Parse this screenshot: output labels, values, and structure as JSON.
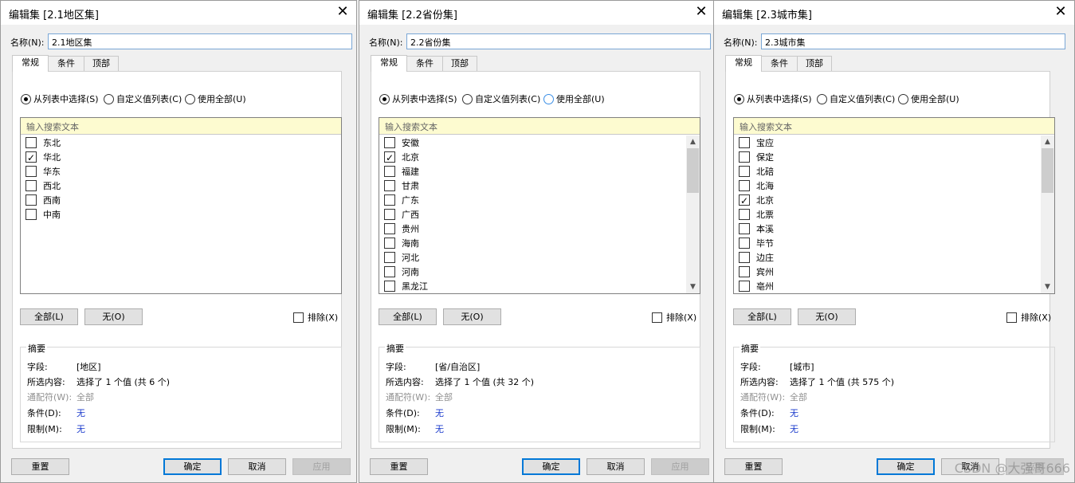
{
  "dialogs": [
    {
      "title": "编辑集 [2.1地区集]",
      "name_label": "名称(N):",
      "name_value": "2.1地区集",
      "tabs": [
        "常规",
        "条件",
        "顶部"
      ],
      "radios": [
        "从列表中选择(S)",
        "自定义值列表(C)",
        "使用全部(U)"
      ],
      "search_placeholder": "输入搜索文本",
      "items": [
        {
          "label": "东北",
          "checked": false
        },
        {
          "label": "华北",
          "checked": true
        },
        {
          "label": "华东",
          "checked": false
        },
        {
          "label": "西北",
          "checked": false
        },
        {
          "label": "西南",
          "checked": false
        },
        {
          "label": "中南",
          "checked": false
        }
      ],
      "btn_all": "全部(L)",
      "btn_none": "无(O)",
      "exclude_label": "排除(X)",
      "summary_title": "摘要",
      "summary": {
        "field_label": "字段:",
        "field_value": "[地区]",
        "selected_label": "所选内容:",
        "selected_value": "选择了 1 个值 (共 6 个)",
        "wildcard_label": "通配符(W):",
        "wildcard_value": "全部",
        "condition_label": "条件(D):",
        "condition_value": "无",
        "limit_label": "限制(M):",
        "limit_value": "无"
      },
      "btn_reset": "重置",
      "btn_ok": "确定",
      "btn_cancel": "取消",
      "btn_apply": "应用"
    },
    {
      "title": "编辑集 [2.2省份集]",
      "name_label": "名称(N):",
      "name_value": "2.2省份集",
      "tabs": [
        "常规",
        "条件",
        "顶部"
      ],
      "radios": [
        "从列表中选择(S)",
        "自定义值列表(C)",
        "使用全部(U)"
      ],
      "search_placeholder": "输入搜索文本",
      "items": [
        {
          "label": "安徽",
          "checked": false
        },
        {
          "label": "北京",
          "checked": true
        },
        {
          "label": "福建",
          "checked": false
        },
        {
          "label": "甘肃",
          "checked": false
        },
        {
          "label": "广东",
          "checked": false
        },
        {
          "label": "广西",
          "checked": false
        },
        {
          "label": "贵州",
          "checked": false
        },
        {
          "label": "海南",
          "checked": false
        },
        {
          "label": "河北",
          "checked": false
        },
        {
          "label": "河南",
          "checked": false
        },
        {
          "label": "黑龙江",
          "checked": false
        }
      ],
      "btn_all": "全部(L)",
      "btn_none": "无(O)",
      "exclude_label": "排除(X)",
      "summary_title": "摘要",
      "summary": {
        "field_label": "字段:",
        "field_value": "[省/自治区]",
        "selected_label": "所选内容:",
        "selected_value": "选择了 1 个值 (共 32 个)",
        "wildcard_label": "通配符(W):",
        "wildcard_value": "全部",
        "condition_label": "条件(D):",
        "condition_value": "无",
        "limit_label": "限制(M):",
        "limit_value": "无"
      },
      "btn_reset": "重置",
      "btn_ok": "确定",
      "btn_cancel": "取消",
      "btn_apply": "应用"
    },
    {
      "title": "编辑集 [2.3城市集]",
      "name_label": "名称(N):",
      "name_value": "2.3城市集",
      "tabs": [
        "常规",
        "条件",
        "顶部"
      ],
      "radios": [
        "从列表中选择(S)",
        "自定义值列表(C)",
        "使用全部(U)"
      ],
      "search_placeholder": "输入搜索文本",
      "items": [
        {
          "label": "宝应",
          "checked": false
        },
        {
          "label": "保定",
          "checked": false
        },
        {
          "label": "北碚",
          "checked": false
        },
        {
          "label": "北海",
          "checked": false
        },
        {
          "label": "北京",
          "checked": true
        },
        {
          "label": "北票",
          "checked": false
        },
        {
          "label": "本溪",
          "checked": false
        },
        {
          "label": "毕节",
          "checked": false
        },
        {
          "label": "边庄",
          "checked": false
        },
        {
          "label": "宾州",
          "checked": false
        },
        {
          "label": "亳州",
          "checked": false
        }
      ],
      "btn_all": "全部(L)",
      "btn_none": "无(O)",
      "exclude_label": "排除(X)",
      "summary_title": "摘要",
      "summary": {
        "field_label": "字段:",
        "field_value": "[城市]",
        "selected_label": "所选内容:",
        "selected_value": "选择了 1 个值 (共 575 个)",
        "wildcard_label": "通配符(W):",
        "wildcard_value": "全部",
        "condition_label": "条件(D):",
        "condition_value": "无",
        "limit_label": "限制(M):",
        "limit_value": "无"
      },
      "btn_reset": "重置",
      "btn_ok": "确定",
      "btn_cancel": "取消",
      "btn_apply": "应用"
    }
  ],
  "watermark": "CSDN @大强哥666"
}
